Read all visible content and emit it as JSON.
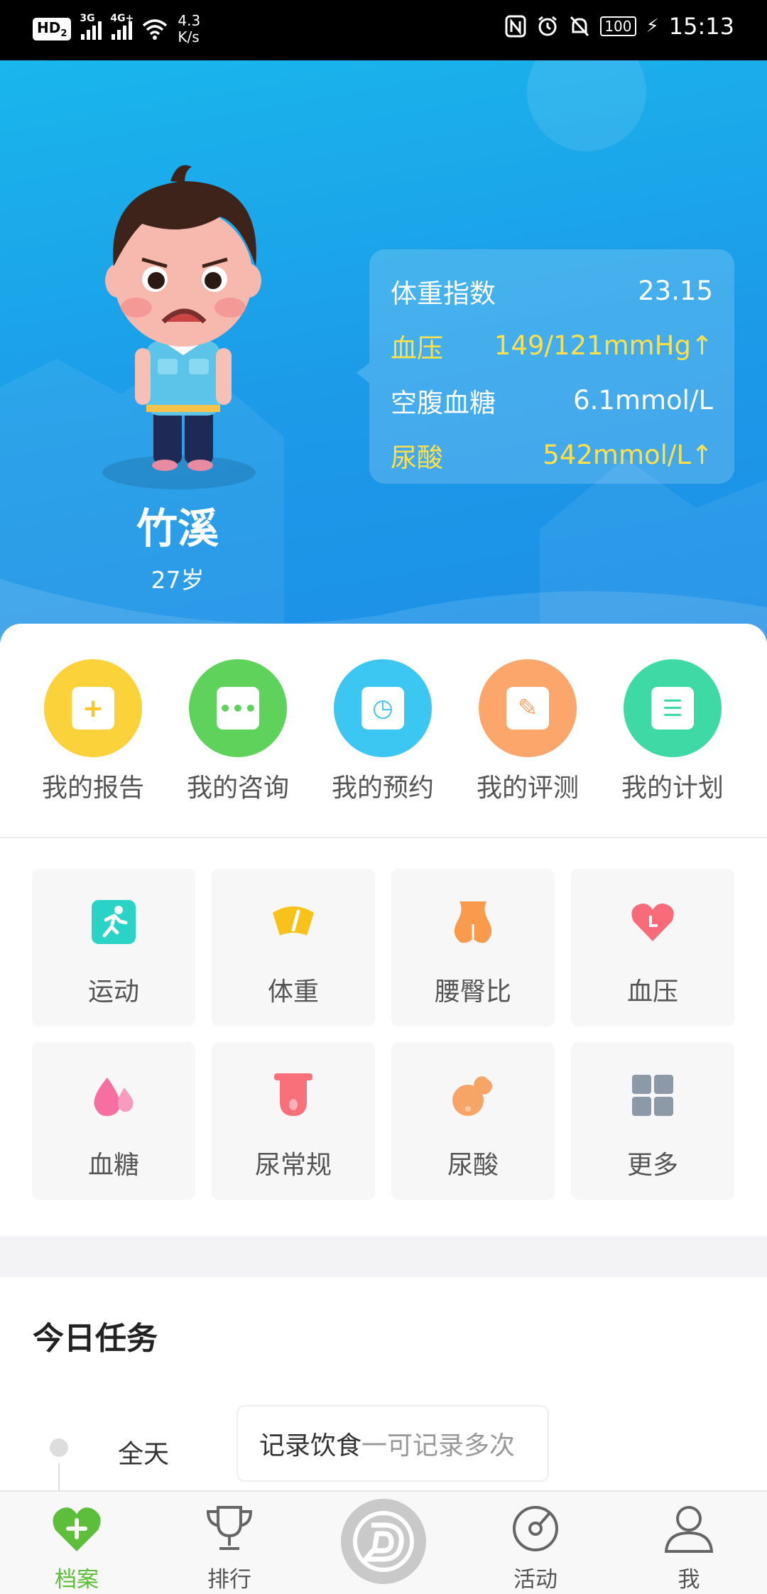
{
  "status_bar": {
    "hd": "HD",
    "sim_slot": "2",
    "network_1": "3G",
    "network_2": "4G+",
    "speed_value": "4.3",
    "speed_unit": "K/s",
    "battery": "100",
    "time": "15:13"
  },
  "profile": {
    "name": "竹溪",
    "age": "27岁"
  },
  "metrics": [
    {
      "label": "体重指数",
      "value": "23.15",
      "alert": false
    },
    {
      "label": "血压",
      "value": "149/121mmHg↑",
      "alert": true
    },
    {
      "label": "空腹血糖",
      "value": "6.1mmol/L",
      "alert": false
    },
    {
      "label": "尿酸",
      "value": "542mmol/L↑",
      "alert": true
    }
  ],
  "quick_actions": [
    {
      "label": "我的报告",
      "icon": "report-icon",
      "color": "#fcd23a"
    },
    {
      "label": "我的咨询",
      "icon": "chat-icon",
      "color": "#5fd25c"
    },
    {
      "label": "我的预约",
      "icon": "clock-icon",
      "color": "#3cc7f2"
    },
    {
      "label": "我的评测",
      "icon": "edit-icon",
      "color": "#fca66c"
    },
    {
      "label": "我的计划",
      "icon": "plan-icon",
      "color": "#3ed9a5"
    }
  ],
  "categories": [
    {
      "label": "运动",
      "icon": "running-icon"
    },
    {
      "label": "体重",
      "icon": "scale-icon"
    },
    {
      "label": "腰臀比",
      "icon": "waist-hip-icon"
    },
    {
      "label": "血压",
      "icon": "heart-icon"
    },
    {
      "label": "血糖",
      "icon": "drop-icon"
    },
    {
      "label": "尿常规",
      "icon": "test-tube-icon"
    },
    {
      "label": "尿酸",
      "icon": "uric-acid-icon"
    },
    {
      "label": "更多",
      "icon": "grid-icon"
    }
  ],
  "tasks": {
    "title": "今日任务",
    "items": [
      {
        "time": "全天",
        "text": "记录饮食",
        "hint": "一可记录多次"
      }
    ]
  },
  "nav": {
    "items": [
      {
        "label": "档案",
        "icon": "heart-plus-icon",
        "active": true
      },
      {
        "label": "排行",
        "icon": "trophy-icon",
        "active": false
      },
      {
        "label": "活动",
        "icon": "compass-icon",
        "active": false
      },
      {
        "label": "我",
        "icon": "person-icon",
        "active": false
      }
    ],
    "center_icon": "brand-logo-icon"
  },
  "colors": {
    "header_start": "#1ab6ec",
    "header_end": "#1d8ee6",
    "alert": "#ffe04a",
    "nav_active": "#5cbe3a"
  }
}
